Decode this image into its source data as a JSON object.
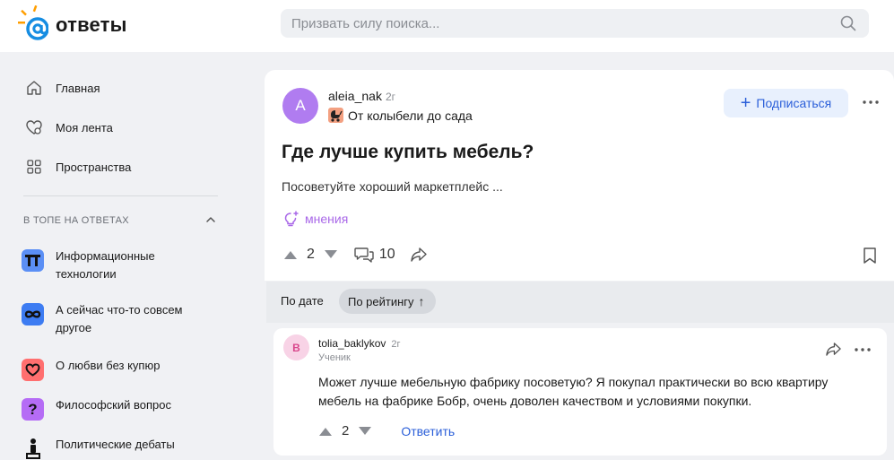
{
  "header": {
    "logo_text": "ответы",
    "search_placeholder": "Призвать силу поиска..."
  },
  "sidebar": {
    "nav": [
      {
        "label": "Главная",
        "icon": "home-icon"
      },
      {
        "label": "Моя лента",
        "icon": "heart-feed-icon"
      },
      {
        "label": "Пространства",
        "icon": "grid-icon"
      }
    ],
    "section_title": "В ТОПЕ НА ОТВЕТАХ",
    "topics": [
      {
        "label": "Информационные технологии",
        "icon": "it-icon",
        "color": "#5b8ff5"
      },
      {
        "label": "А сейчас что-то совсем другое",
        "icon": "infinity-icon",
        "color": "#3d7cf2"
      },
      {
        "label": "О любви без купюр",
        "icon": "heart-icon",
        "color": "#ff6f6f"
      },
      {
        "label": "Философский вопрос",
        "icon": "question-icon",
        "color": "#b56cf5"
      },
      {
        "label": "Политические дебаты",
        "icon": "debate-icon",
        "color": "#888888"
      }
    ]
  },
  "question": {
    "avatar_letter": "A",
    "author": "aleia_nak",
    "time": "2г",
    "category": "От колыбели до сада",
    "subscribe_label": "Подписаться",
    "title": "Где лучше купить мебель?",
    "body": "Посоветуйте хороший маркетплейс ...",
    "opinions_label": "мнения",
    "votes": "2",
    "comments": "10"
  },
  "sort": {
    "by_date": "По дате",
    "by_rating": "По рейтингу"
  },
  "answer": {
    "avatar_letter": "B",
    "author": "tolia_baklykov",
    "time": "2г",
    "role": "Ученик",
    "text": "Может лучше мебельную фабрику посоветую? Я покупал практически во всю квартиру мебель на фабрике Бобр, очень доволен качеством и условиями покупки.",
    "votes": "2",
    "reply_label": "Ответить"
  },
  "colors": {
    "accent": "#2b5fd9",
    "brand_orange": "#ff9e00",
    "brand_blue": "#168de2",
    "opinions": "#a968e8"
  }
}
